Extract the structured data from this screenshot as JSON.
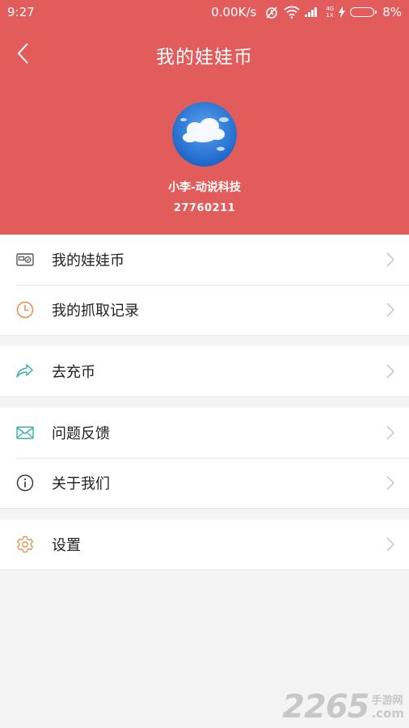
{
  "status_bar": {
    "time": "9:27",
    "net_speed": "0.00K/s",
    "network_label_top": "4G",
    "network_label_bottom": "1X",
    "battery": "8%"
  },
  "header": {
    "title": "我的娃娃币",
    "back_icon": "chevron-left-icon",
    "background_color": "#e35c5c"
  },
  "profile": {
    "username": "小李-动说科技",
    "user_id": "27760211",
    "avatar": "sky-cloud-avatar"
  },
  "menu": {
    "group1": [
      {
        "label": "我的娃娃币",
        "icon": "wallet-icon",
        "icon_color": "#555555"
      },
      {
        "label": "我的抓取记录",
        "icon": "clock-icon",
        "icon_color": "#f08a4b"
      }
    ],
    "group2": [
      {
        "label": "去充币",
        "icon": "share-arrow-icon",
        "icon_color": "#3ab0a2"
      }
    ],
    "group3": [
      {
        "label": "问题反馈",
        "icon": "mail-icon",
        "icon_color": "#3ab0a2"
      },
      {
        "label": "关于我们",
        "icon": "info-icon",
        "icon_color": "#333333"
      }
    ],
    "group4": [
      {
        "label": "设置",
        "icon": "gear-icon",
        "icon_color": "#f08a4b"
      }
    ]
  },
  "watermark": {
    "number": "2265",
    "site_cn": "手游网",
    "site_domain": ".com"
  }
}
